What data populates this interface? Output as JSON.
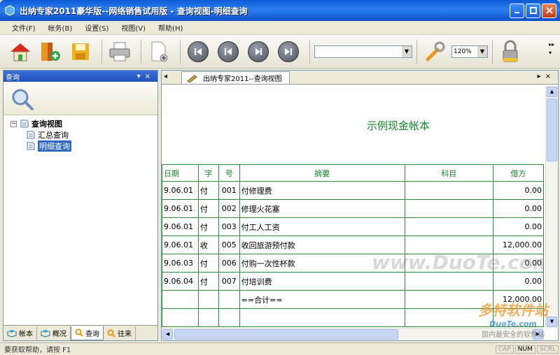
{
  "window": {
    "title": "出纳专家2011豪华版--网络销售试用版 - 查询视图-明细查询"
  },
  "menu": [
    "文件(F)",
    "帐务(B)",
    "设置(S)",
    "视图(V)",
    "帮助(H)"
  ],
  "toolbar": {
    "icons": [
      "home-icon",
      "add-book-icon",
      "save-icon",
      "print-icon",
      "new-document-icon",
      "first-icon",
      "previous-icon",
      "next-icon",
      "last-icon",
      "settings-icon",
      "lock-icon"
    ],
    "combo_value": "",
    "zoom": "120%"
  },
  "left_panel": {
    "title": "查询",
    "tree_root": "查询视图",
    "tree_items": [
      "汇总查询",
      "明细查询"
    ],
    "selected": "明细查询",
    "bottom_tabs": [
      "帐本",
      "概况",
      "查询",
      "往来"
    ],
    "active_tab": "查询"
  },
  "document": {
    "tab_label": "出纳专家2011--查询视图",
    "title": "示例现金帐本",
    "columns": [
      "日期",
      "字",
      "号",
      "摘要",
      "科目",
      "借方"
    ],
    "rows": [
      [
        "9.06.01",
        "付",
        "001",
        "付修理费",
        "",
        "0.00"
      ],
      [
        "9.06.01",
        "付",
        "002",
        "修理火花塞",
        "",
        "0.00"
      ],
      [
        "9.06.01",
        "付",
        "003",
        "付工人工资",
        "",
        "0.00"
      ],
      [
        "9.06.01",
        "收",
        "005",
        "收回旅游预付款",
        "",
        "12,000.00"
      ],
      [
        "9.06.03",
        "付",
        "006",
        "付购一次性杯款",
        "",
        "0.00"
      ],
      [
        "9.06.04",
        "付",
        "007",
        "付培训费",
        "",
        "0.00"
      ],
      [
        "",
        "",
        "",
        "==合计==",
        "",
        "12,000.00"
      ],
      [
        "",
        "",
        "",
        "",
        "",
        ""
      ]
    ]
  },
  "statusbar": {
    "message": "要获取帮助，请按 F1",
    "indicators": [
      "CAP",
      "NUM",
      "SCRL"
    ]
  },
  "watermarks": {
    "center": "www.DuoTe.com",
    "brand": "多特软件站",
    "brand_url": "DuoTe.com",
    "slogan": "国内最安全的软件站"
  },
  "colors": {
    "title_blue": "#0a5ad8",
    "grid_green": "#2e8b3f",
    "title_green": "#17862a",
    "select_blue": "#316ac5"
  }
}
